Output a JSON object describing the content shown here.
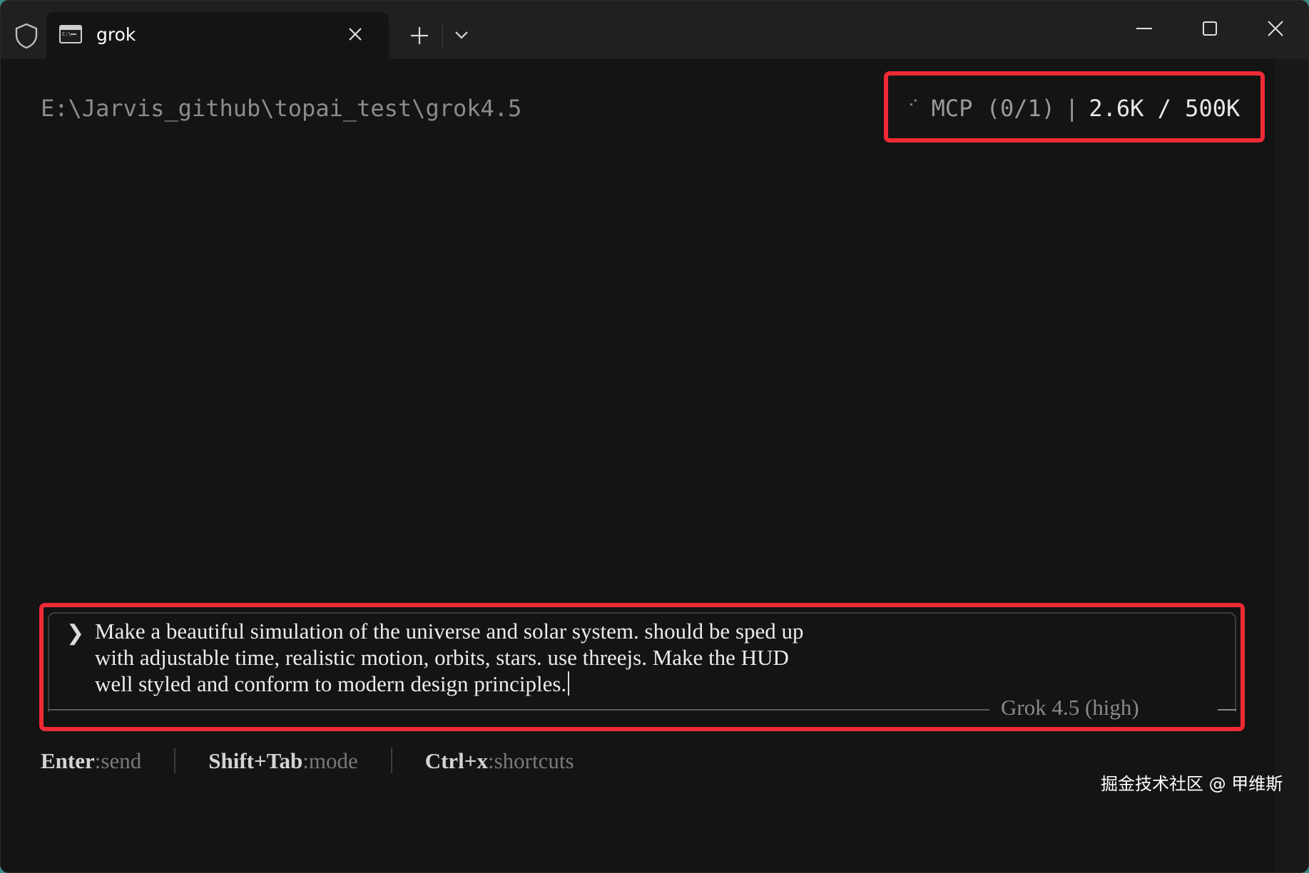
{
  "window": {
    "tab_title": "grok"
  },
  "terminal": {
    "cwd": "E:\\Jarvis_github\\topai_test\\grok4.5",
    "status": {
      "spinner": "⠊",
      "mcp": "MCP (0/1)",
      "separator": "|",
      "tokens": "2.6K / 500K"
    },
    "prompt": {
      "chevron": "❯",
      "text": "Make a beautiful simulation of the universe and solar system. should be sped up\nwith adjustable time, realistic motion, orbits, stars. use threejs. Make the HUD\nwell styled and conform to modern design principles.",
      "model": "Grok 4.5 (high)"
    },
    "hints": [
      {
        "key": "Enter",
        "action": "send"
      },
      {
        "key": "Shift+Tab",
        "action": "mode"
      },
      {
        "key": "Ctrl+x",
        "action": "shortcuts"
      }
    ],
    "hint_colon": ":"
  },
  "watermark": "掘金技术社区 @ 甲维斯",
  "colors": {
    "highlight_box": "#ee2a35",
    "background": "#141414",
    "titlebar": "#202020"
  }
}
